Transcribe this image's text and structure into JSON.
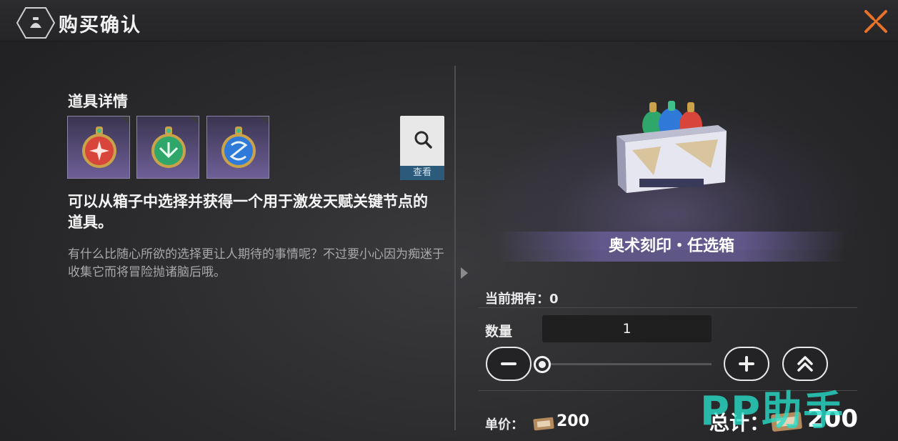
{
  "header": {
    "title": "购买确认",
    "back_icon": "bag-icon",
    "close_icon": "close-icon",
    "accent_color": "#e8722a"
  },
  "details": {
    "section_title": "道具详情",
    "items": [
      {
        "icon": "red-seal-icon",
        "color": "#d8453a"
      },
      {
        "icon": "green-seal-icon",
        "color": "#2fa66a"
      },
      {
        "icon": "blue-seal-icon",
        "color": "#2f7ad8"
      }
    ],
    "view_label": "查看",
    "description": "可以从箱子中选择并获得一个用于激发天赋关键节点的道具。",
    "flavor": "有什么比随心所欲的选择更让人期待的事情呢？不过要小心因为痴迷于收集它而将冒险抛诸脑后哦。"
  },
  "product": {
    "name": "奥术刻印・任选箱",
    "owned_label": "当前拥有：",
    "owned_value": "0",
    "quantity_label": "数量",
    "quantity_value": "1",
    "slider_fraction": 0.0,
    "unit_label": "单价：",
    "unit_price": "200",
    "total_label": "总计：",
    "total_price": "200",
    "currency_icon": "ticket-icon"
  },
  "watermark": "PP助手"
}
